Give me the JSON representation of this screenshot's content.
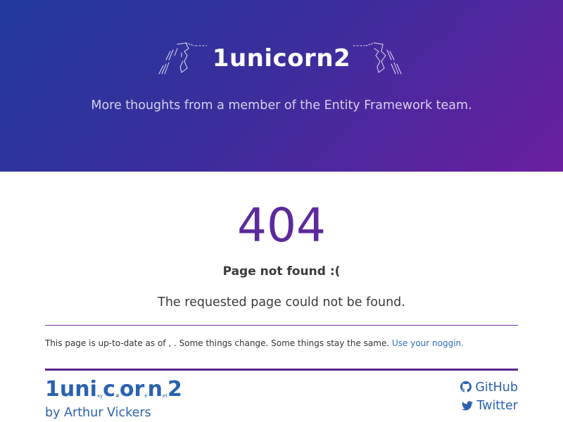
{
  "header": {
    "site_title": "1unicorn2",
    "subtitle": "More thoughts from a member of the Entity Framework team.",
    "left_logo_icon": "ascii-unicorn-icon",
    "right_logo_icon": "ascii-unicorn-icon"
  },
  "error": {
    "code": "404",
    "title": "Page not found :(",
    "message": "The requested page could not be found."
  },
  "notice": {
    "text": "This page is up-to-date as of , . Some things change. Some things stay the same. ",
    "link_label": "Use your noggin."
  },
  "footer": {
    "brand": {
      "p1": "1uni",
      "s1": "xy",
      "p2": "c",
      "s2": "#",
      "p3": "or",
      "s3": "e",
      "p4": "n",
      "s4": "et",
      "p5": "2"
    },
    "author": "by Arthur Vickers",
    "links": [
      {
        "label": "GitHub",
        "icon": "github-icon"
      },
      {
        "label": "Twitter",
        "icon": "twitter-icon"
      }
    ]
  },
  "colors": {
    "hero_start": "#223a9e",
    "hero_end": "#6a1ea0",
    "accent_purple": "#5c2a9c",
    "link_blue": "#2a62b0"
  }
}
